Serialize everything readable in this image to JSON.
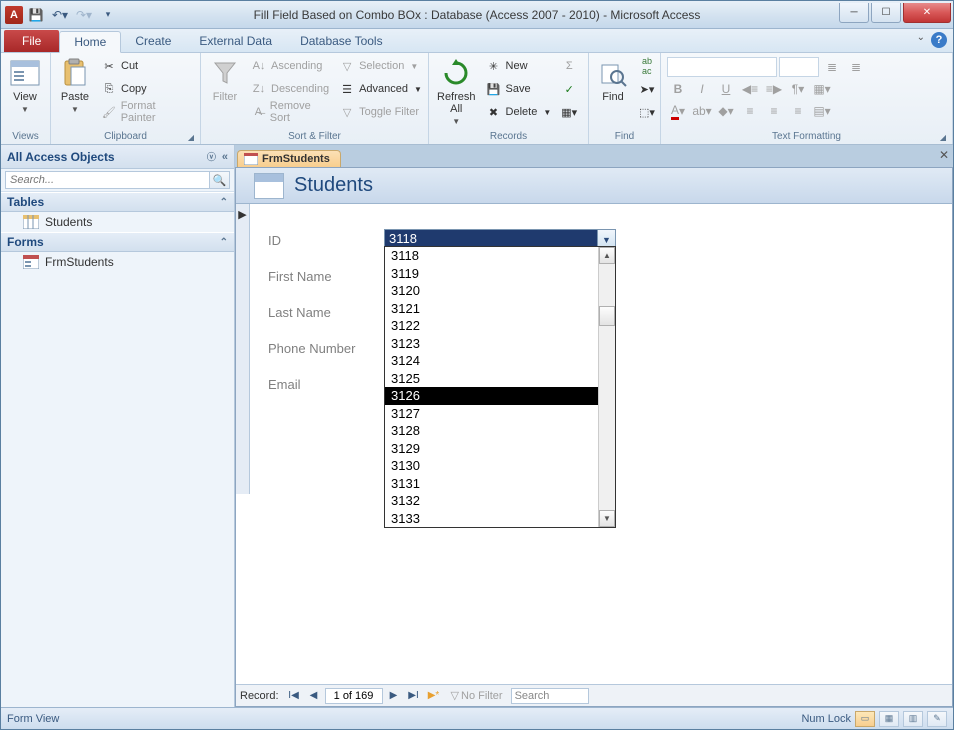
{
  "titlebar": {
    "app_letter": "A",
    "title": "Fill Field Based on Combo BOx : Database (Access 2007 - 2010)  -  Microsoft Access"
  },
  "tabs": {
    "file": "File",
    "home": "Home",
    "create": "Create",
    "external": "External Data",
    "dbtools": "Database Tools"
  },
  "ribbon": {
    "views": {
      "view": "View",
      "label": "Views"
    },
    "clipboard": {
      "paste": "Paste",
      "cut": "Cut",
      "copy": "Copy",
      "fmt": "Format Painter",
      "label": "Clipboard"
    },
    "sortfilter": {
      "filter": "Filter",
      "asc": "Ascending",
      "desc": "Descending",
      "remove": "Remove Sort",
      "selection": "Selection",
      "advanced": "Advanced",
      "toggle": "Toggle Filter",
      "label": "Sort & Filter"
    },
    "records": {
      "refresh": "Refresh\nAll",
      "new": "New",
      "save": "Save",
      "delete": "Delete",
      "totals": "Σ",
      "spell": "✓",
      "more": "⋯",
      "label": "Records"
    },
    "find": {
      "find": "Find",
      "label": "Find"
    },
    "text": {
      "label": "Text Formatting"
    }
  },
  "nav": {
    "header": "All Access Objects",
    "search_ph": "Search...",
    "tables": "Tables",
    "t1": "Students",
    "forms": "Forms",
    "f1": "FrmStudents"
  },
  "doc": {
    "tab": "FrmStudents",
    "form_title": "Students",
    "labels": {
      "id": "ID",
      "fn": "First Name",
      "ln": "Last Name",
      "ph": "Phone Number",
      "em": "Email"
    },
    "combo_value": "3118",
    "dd_items": [
      "3118",
      "3119",
      "3120",
      "3121",
      "3122",
      "3123",
      "3124",
      "3125",
      "3126",
      "3127",
      "3128",
      "3129",
      "3130",
      "3131",
      "3132",
      "3133"
    ],
    "dd_selected": "3126"
  },
  "recnav": {
    "label": "Record:",
    "pos": "1 of 169",
    "filter": "No Filter",
    "search": "Search"
  },
  "status": {
    "left": "Form View",
    "numlock": "Num Lock"
  }
}
